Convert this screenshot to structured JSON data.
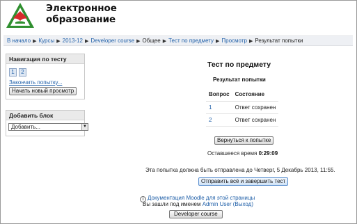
{
  "header": {
    "title_line1": "Электронное",
    "title_line2": "образование"
  },
  "breadcrumb": [
    "В начало",
    "Курсы",
    "2013-12",
    "Developer course",
    "Общее",
    "Тест по предмету",
    "Просмотр",
    "Результат попытки"
  ],
  "nav_block": {
    "title": "Навигация по тесту",
    "question_buttons": [
      "1",
      "2"
    ],
    "finish_link": "Закончить попытку...",
    "new_preview_button": "Начать новый просмотр"
  },
  "add_block": {
    "title": "Добавить блок",
    "select_value": "Добавить..."
  },
  "main": {
    "quiz_title": "Тест по предмету",
    "summary_title": "Результат попытки",
    "table": {
      "headers": [
        "Вопрос",
        "Состояние"
      ],
      "rows": [
        [
          "1",
          "Ответ сохранен"
        ],
        [
          "2",
          "Ответ сохранен"
        ]
      ]
    },
    "return_button": "Вернуться к попытке",
    "time_left_label": "Оставшееся время",
    "time_left_value": "0:29:09",
    "deadline_text": "Эта попытка должна быть отправлена до Четверг, 5 Декабрь 2013, 11:55.",
    "submit_button": "Отправить всё и завершить тест"
  },
  "footer": {
    "doc_link": "Документация Moodle для этой страницы",
    "logged_in_as": "Вы зашли под именем",
    "user_name": "Admin User",
    "logout": "(Выход)",
    "course_button": "Developer course"
  },
  "colors": {
    "link": "#1f5fa8",
    "logo_green": "#2f8f2f",
    "logo_red": "#d62b2b"
  }
}
